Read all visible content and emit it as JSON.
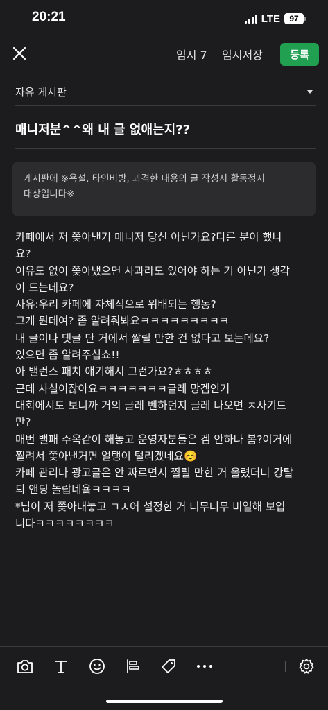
{
  "status_bar": {
    "time": "20:21",
    "network": "LTE",
    "battery": "97"
  },
  "top_bar": {
    "draft_count": "임시 7",
    "draft_save": "임시저장",
    "submit": "등록"
  },
  "board": {
    "selected": "자유 게시판"
  },
  "post": {
    "title": "매니저분^^왜 내 글 없애는지??",
    "notice_lines": [
      "게시판에 ※욕설, 타인비방, 과격한 내용의 글 작성시 활동정지",
      "대상입니다※"
    ],
    "body_lines": [
      "카페에서 저 쫒아낸거 매니저 당신 아닌가요?다른 분이 했나",
      "요?",
      "이유도 없이 쫒아냈으면 사과라도 있어야 하는 거 아닌가 생각",
      "이 드는데요?",
      "사유:우리 카페에 자체적으로 위배되는 행동?",
      "그게 뭔데여? 좀 알려줘봐요ㅋㅋㅋㅋㅋㅋㅋㅋㅋ",
      "내 글이나 댓글 단 거에서 짤릴 만한 건 없다고 보는데요?",
      "있으면 좀 알려주십쇼!!",
      "아 밸런스 패치 얘기해서 그런가요?ㅎㅎㅎㅎ",
      "근데 사실이잖아요ㅋㅋㅋㅋㅋㅋㅋ글레 망겜인거",
      "대회에서도 보니까 거의 글레 벤하던지 글레 나오면 ㅈ사기드",
      "만?",
      "매번 밸패 주옥같이 해놓고 운영자분들은 겜 안하나 봄?이거에",
      "찔려서 쫒아낸거면 얼탱이 털리겠네요☺️",
      "카페 관리나 광고글은 안 짜르면서 찔릴 만한 거 올렸더니 강탈",
      "퇴 앤딩 놀랍네욬ㅋㅋㅋㅋ",
      "*님이 저 쫒아내놓고 ㄱㅊ어 설정한 거  너무너무 비열해 보입",
      "니다ㅋㅋㅋㅋㅋㅋㅋㅋ"
    ]
  },
  "toolbar": {
    "icons": [
      "camera-icon",
      "text-icon",
      "emoji-icon",
      "align-icon",
      "tag-icon",
      "more-icon",
      "settings-icon"
    ]
  }
}
